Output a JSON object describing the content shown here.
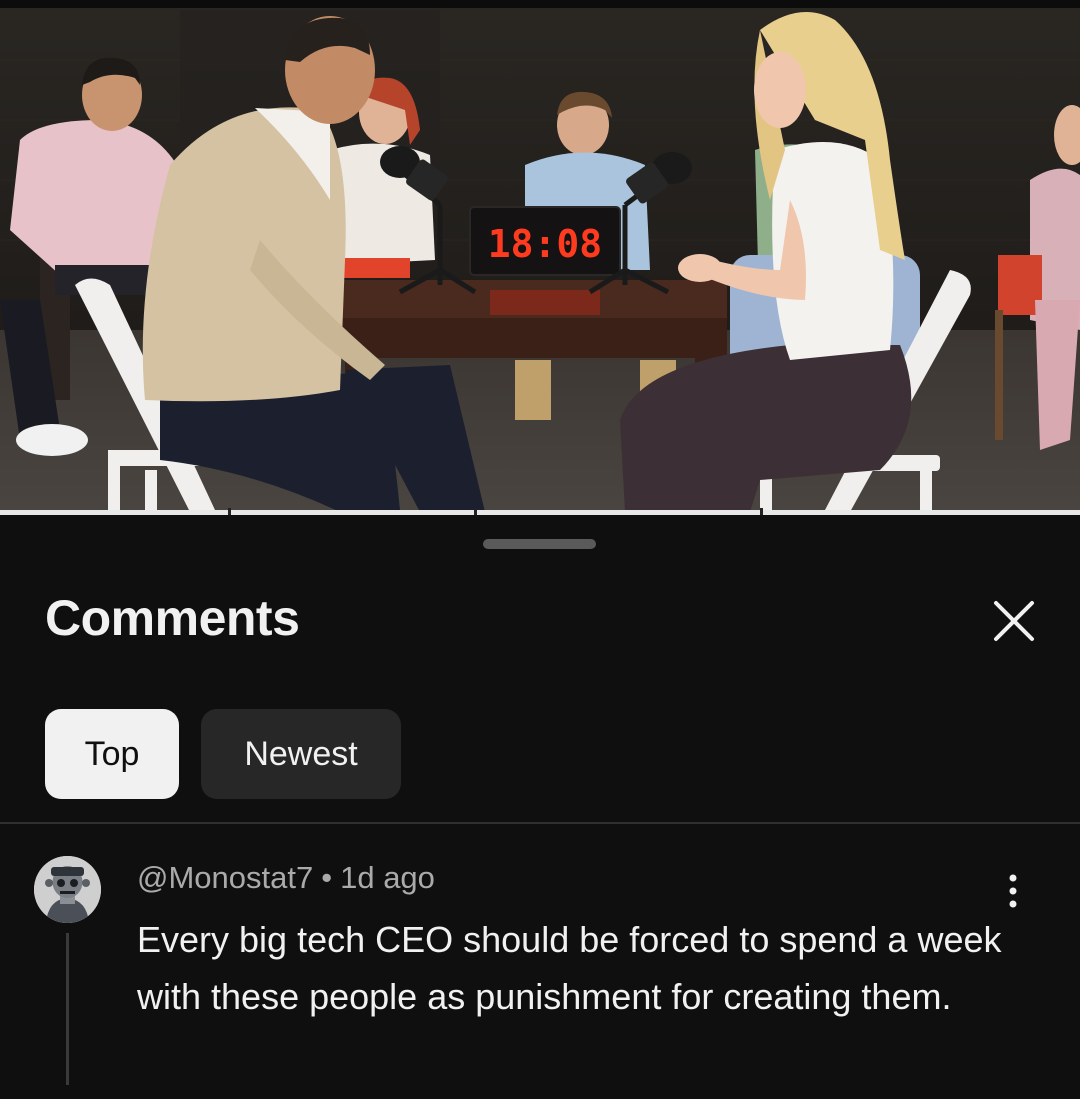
{
  "video": {
    "timer_display": "18:08"
  },
  "comments_panel": {
    "title": "Comments",
    "filters": [
      {
        "label": "Top",
        "selected": true
      },
      {
        "label": "Newest",
        "selected": false
      }
    ],
    "comment": {
      "author": "@Monostat7",
      "separator": "•",
      "time": "1d ago",
      "text": "Every big tech CEO should be forced to spend a week with these people as punishment for creating them."
    }
  },
  "colors": {
    "background": "#0f0f0f",
    "chip_selected": "#f1f1f1",
    "chip_unselected": "#272727",
    "timer_led": "#ff3b1f"
  },
  "icons": {
    "close": "close-icon",
    "more": "more-vert-icon",
    "avatar": "robot-avatar"
  }
}
